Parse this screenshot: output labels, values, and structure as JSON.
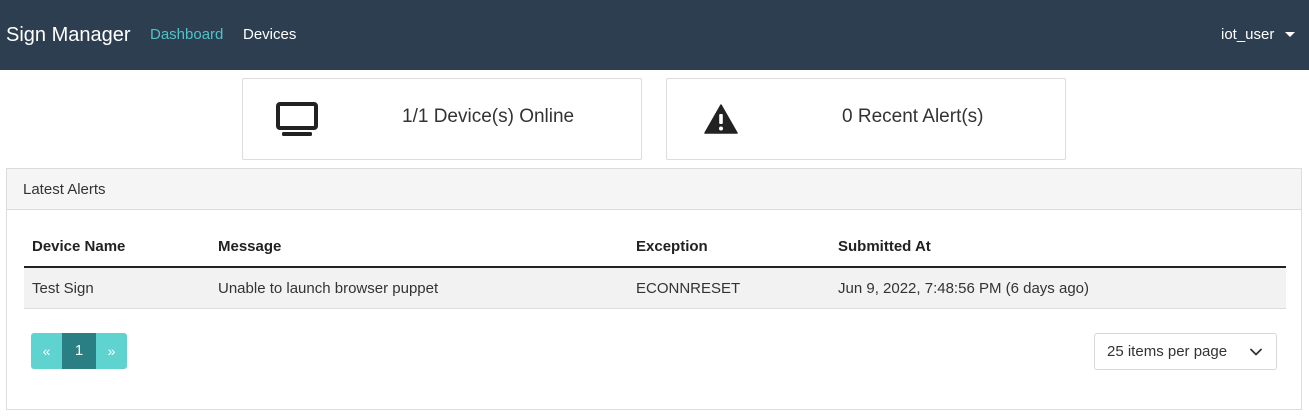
{
  "navbar": {
    "brand": "Sign Manager",
    "links": [
      {
        "label": "Dashboard",
        "active": true
      },
      {
        "label": "Devices",
        "active": false
      }
    ],
    "user": "iot_user",
    "background": "#2c3e50",
    "active_link_color": "#4fc3c8"
  },
  "stats": [
    {
      "icon": "monitor-icon",
      "text": "1/1 Device(s) Online"
    },
    {
      "icon": "warning-icon",
      "text": "0 Recent Alert(s)"
    }
  ],
  "alerts_panel": {
    "title": "Latest Alerts",
    "columns": [
      "Device Name",
      "Message",
      "Exception",
      "Submitted At"
    ],
    "rows": [
      [
        "Test Sign",
        "Unable to launch browser puppet",
        "ECONNRESET",
        "Jun 9, 2022, 7:48:56 PM (6 days ago)"
      ]
    ]
  },
  "pagination": {
    "prev": "«",
    "pages": [
      "1"
    ],
    "current": "1",
    "next": "»",
    "accent": "#5fd3cf",
    "active_color": "#2a7f84"
  },
  "page_size": {
    "selected": "25 items per page"
  }
}
